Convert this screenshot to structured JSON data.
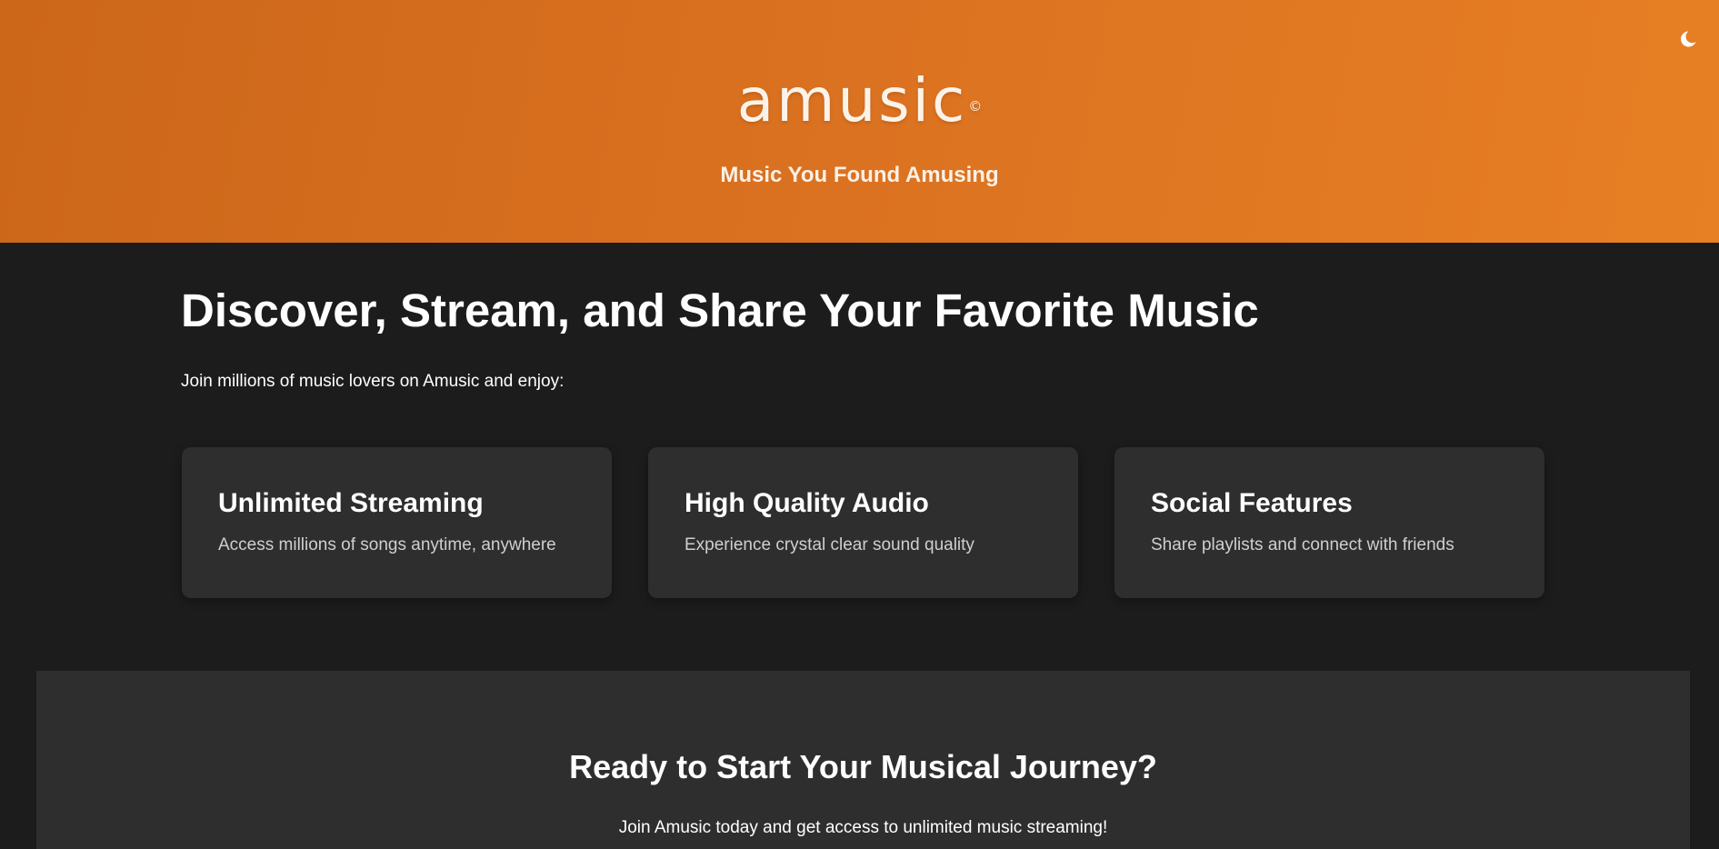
{
  "header": {
    "logo_text": "amusic",
    "logo_mark": "©",
    "tagline": "Music You Found Amusing",
    "theme_toggle_icon": "moon-icon"
  },
  "hero": {
    "heading": "Discover, Stream, and Share Your Favorite Music",
    "subheading": "Join millions of music lovers on Amusic and enjoy:"
  },
  "features": [
    {
      "title": "Unlimited Streaming",
      "text": "Access millions of songs anytime, anywhere"
    },
    {
      "title": "High Quality Audio",
      "text": "Experience crystal clear sound quality"
    },
    {
      "title": "Social Features",
      "text": "Share playlists and connect with friends"
    }
  ],
  "cta": {
    "heading": "Ready to Start Your Musical Journey?",
    "text": "Join Amusic today and get access to unlimited music streaming!"
  },
  "colors": {
    "header_gradient_start": "#cc6619",
    "header_gradient_end": "#e77f24",
    "page_background": "#1c1c1c",
    "card_background": "#2e2e2e",
    "text_primary": "#ffffff",
    "text_secondary": "#cfcfcf"
  }
}
